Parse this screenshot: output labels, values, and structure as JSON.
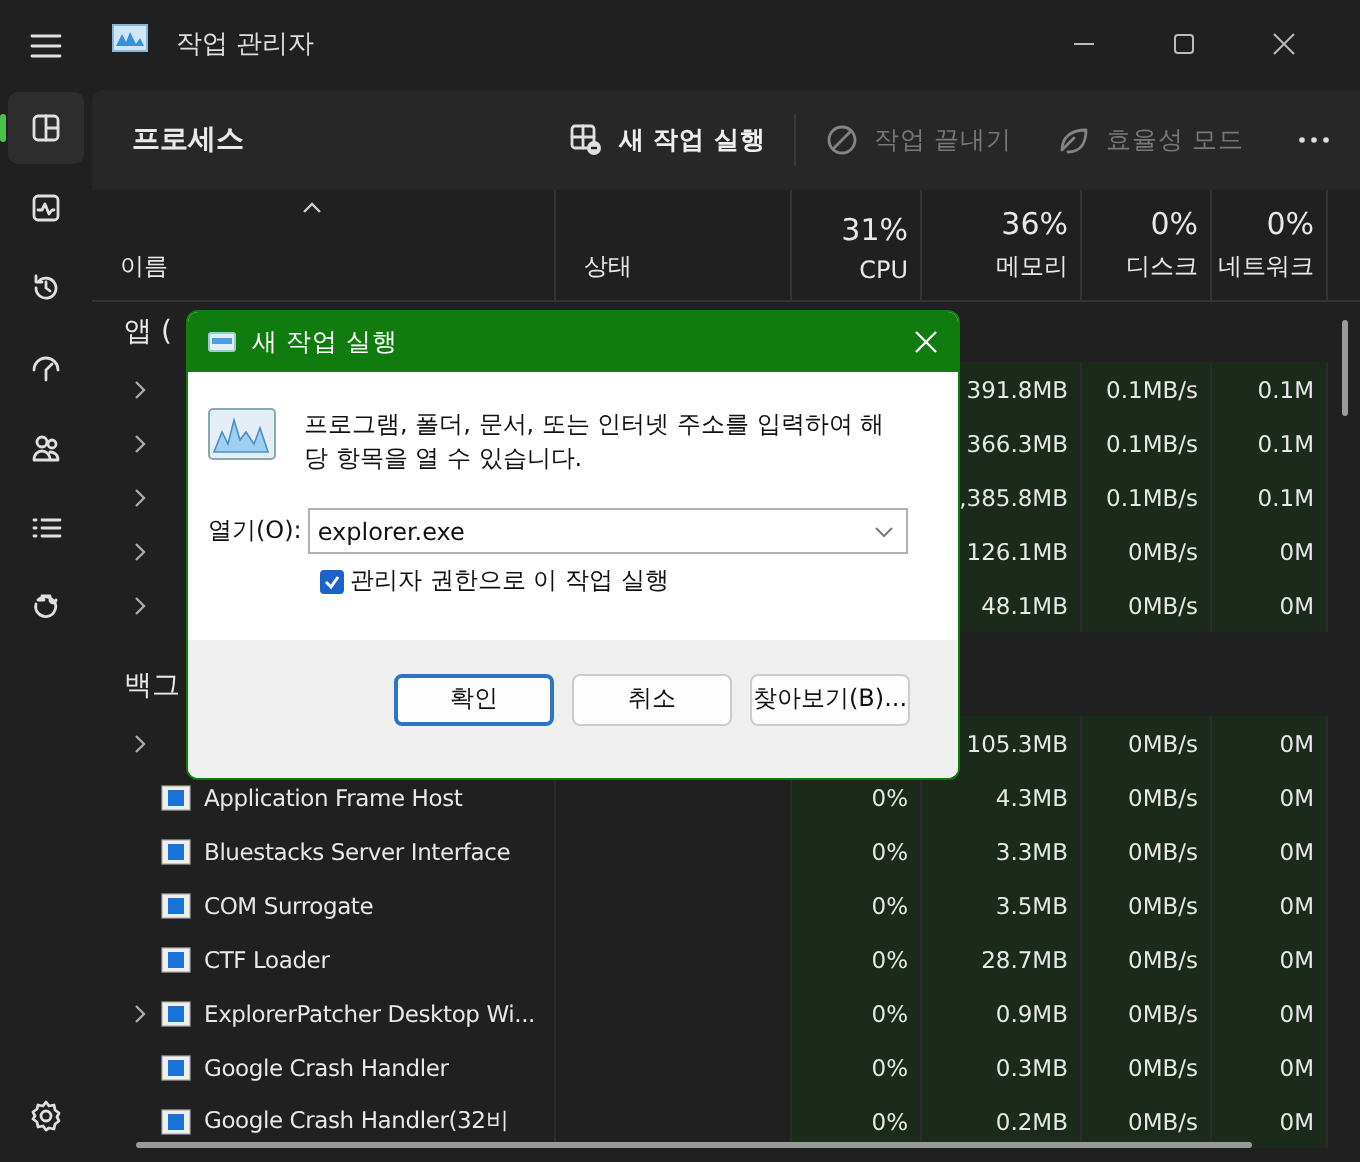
{
  "window": {
    "title": "작업 관리자"
  },
  "sidebar": {
    "items": [
      {
        "kind": "processes",
        "selected": true
      },
      {
        "kind": "performance",
        "selected": false
      },
      {
        "kind": "history",
        "selected": false
      },
      {
        "kind": "startup",
        "selected": false
      },
      {
        "kind": "users",
        "selected": false
      },
      {
        "kind": "details",
        "selected": false
      },
      {
        "kind": "services",
        "selected": false
      }
    ]
  },
  "toolbar": {
    "title": "프로세스",
    "actions": [
      {
        "kind": "run",
        "label": "새 작업 실행",
        "disabled": false
      },
      {
        "kind": "end",
        "label": "작업 끝내기",
        "disabled": true
      },
      {
        "kind": "efficiency",
        "label": "효율성 모드",
        "disabled": true
      }
    ]
  },
  "table": {
    "columns": [
      {
        "label": "이름"
      },
      {
        "label": "상태"
      },
      {
        "percent": "31%",
        "label": "CPU"
      },
      {
        "percent": "36%",
        "label": "메모리"
      },
      {
        "percent": "0%",
        "label": "디스크"
      },
      {
        "percent": "0%",
        "label": "네트워크"
      }
    ],
    "groups": [
      {
        "title": "앱 (",
        "rows": [
          {
            "expandable": true,
            "memory": "391.8MB",
            "disk": "0.1MB/s",
            "network": "0.1M"
          },
          {
            "expandable": true,
            "memory": "366.3MB",
            "disk": "0.1MB/s",
            "network": "0.1M"
          },
          {
            "expandable": true,
            "memory": ",385.8MB",
            "disk": "0.1MB/s",
            "network": "0.1M"
          },
          {
            "expandable": true,
            "memory": "126.1MB",
            "disk": "0MB/s",
            "network": "0M"
          },
          {
            "expandable": true,
            "memory": "48.1MB",
            "disk": "0MB/s",
            "network": "0M"
          }
        ]
      },
      {
        "title": "백그",
        "rows": [
          {
            "expandable": true,
            "memory": "105.3MB",
            "disk": "0MB/s",
            "network": "0M"
          },
          {
            "expandable": false,
            "name": "Application Frame Host",
            "cpu": "0%",
            "memory": "4.3MB",
            "disk": "0MB/s",
            "network": "0M"
          },
          {
            "expandable": false,
            "name": "Bluestacks Server Interface",
            "cpu": "0%",
            "memory": "3.3MB",
            "disk": "0MB/s",
            "network": "0M"
          },
          {
            "expandable": false,
            "name": "COM Surrogate",
            "cpu": "0%",
            "memory": "3.5MB",
            "disk": "0MB/s",
            "network": "0M"
          },
          {
            "expandable": false,
            "name": "CTF Loader",
            "cpu": "0%",
            "memory": "28.7MB",
            "disk": "0MB/s",
            "network": "0M"
          },
          {
            "expandable": true,
            "name": "ExplorerPatcher Desktop Wi...",
            "cpu": "0%",
            "memory": "0.9MB",
            "disk": "0MB/s",
            "network": "0M"
          },
          {
            "expandable": false,
            "name": "Google Crash Handler",
            "cpu": "0%",
            "memory": "0.3MB",
            "disk": "0MB/s",
            "network": "0M"
          },
          {
            "expandable": false,
            "name": "Google Crash Handler(32비",
            "cpu": "0%",
            "memory": "0.2MB",
            "disk": "0MB/s",
            "network": "0M"
          }
        ]
      }
    ]
  },
  "dialog": {
    "title": "새 작업 실행",
    "message": "프로그램, 폴더, 문서, 또는 인터넷 주소를 입력하여 해당 항목을 열 수 있습니다.",
    "open_label": "열기(O):",
    "value": "explorer.exe",
    "admin": {
      "label": "관리자 권한으로 이 작업 실행",
      "checked": true
    },
    "buttons": [
      {
        "label": "확인",
        "default": true
      },
      {
        "label": "취소",
        "default": false
      },
      {
        "label": "찾아보기(B)...",
        "default": false
      }
    ]
  }
}
